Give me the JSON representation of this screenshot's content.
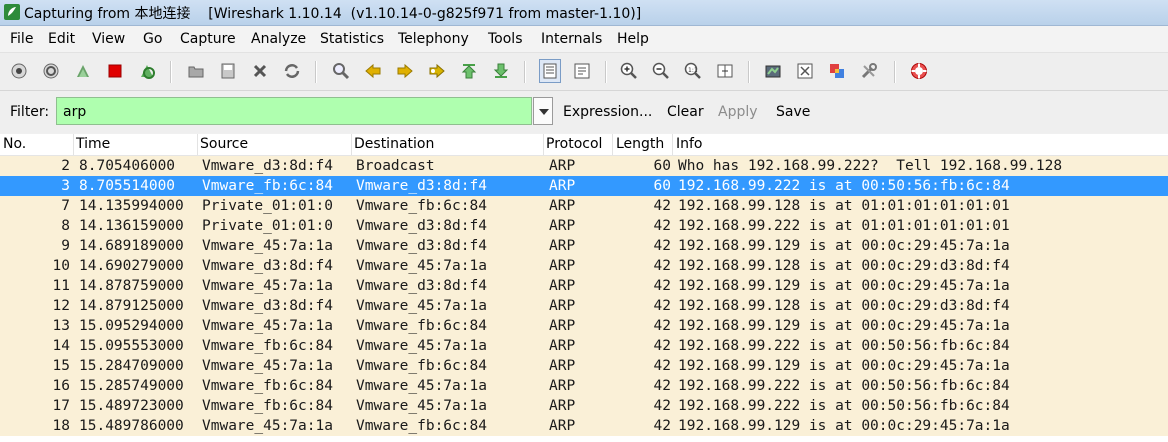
{
  "window": {
    "title": "Capturing from 本地连接    [Wireshark 1.10.14  (v1.10.14-0-g825f971 from master-1.10)]"
  },
  "menu": [
    "File",
    "Edit",
    "View",
    "Go",
    "Capture",
    "Analyze",
    "Statistics",
    "Telephony",
    "Tools",
    "Internals",
    "Help"
  ],
  "toolbar": {
    "icons": [
      "interface-list",
      "capture-options",
      "start-capture",
      "stop-capture",
      "restart-capture",
      "open-file",
      "save-file",
      "close-file",
      "reload-file",
      "find-packet",
      "go-back",
      "go-forward",
      "go-to-packet",
      "go-first",
      "go-last",
      "colorize",
      "auto-scroll",
      "zoom-in",
      "zoom-out",
      "normal-size",
      "resize-columns",
      "capture-filters",
      "display-filters",
      "coloring-rules",
      "preferences",
      "help"
    ]
  },
  "filter": {
    "label": "Filter:",
    "value": "arp",
    "expression_label": "Expression...",
    "clear_label": "Clear",
    "apply_label": "Apply",
    "save_label": "Save"
  },
  "columns": [
    "No.",
    "Time",
    "Source",
    "Destination",
    "Protocol",
    "Length",
    "Info"
  ],
  "packets": [
    {
      "no": "2",
      "time": "8.705406000",
      "source": "Vmware_d3:8d:f4",
      "destination": "Broadcast",
      "protocol": "ARP",
      "length": "60",
      "info": "Who has 192.168.99.222?  Tell 192.168.99.128",
      "selected": false
    },
    {
      "no": "3",
      "time": "8.705514000",
      "source": "Vmware_fb:6c:84",
      "destination": "Vmware_d3:8d:f4",
      "protocol": "ARP",
      "length": "60",
      "info": "192.168.99.222 is at 00:50:56:fb:6c:84",
      "selected": true
    },
    {
      "no": "7",
      "time": "14.135994000",
      "source": "Private_01:01:0",
      "destination": "Vmware_fb:6c:84",
      "protocol": "ARP",
      "length": "42",
      "info": "192.168.99.128 is at 01:01:01:01:01:01",
      "selected": false
    },
    {
      "no": "8",
      "time": "14.136159000",
      "source": "Private_01:01:0",
      "destination": "Vmware_d3:8d:f4",
      "protocol": "ARP",
      "length": "42",
      "info": "192.168.99.222 is at 01:01:01:01:01:01",
      "selected": false
    },
    {
      "no": "9",
      "time": "14.689189000",
      "source": "Vmware_45:7a:1a",
      "destination": "Vmware_d3:8d:f4",
      "protocol": "ARP",
      "length": "42",
      "info": "192.168.99.129 is at 00:0c:29:45:7a:1a",
      "selected": false
    },
    {
      "no": "10",
      "time": "14.690279000",
      "source": "Vmware_d3:8d:f4",
      "destination": "Vmware_45:7a:1a",
      "protocol": "ARP",
      "length": "42",
      "info": "192.168.99.128 is at 00:0c:29:d3:8d:f4",
      "selected": false
    },
    {
      "no": "11",
      "time": "14.878759000",
      "source": "Vmware_45:7a:1a",
      "destination": "Vmware_d3:8d:f4",
      "protocol": "ARP",
      "length": "42",
      "info": "192.168.99.129 is at 00:0c:29:45:7a:1a",
      "selected": false
    },
    {
      "no": "12",
      "time": "14.879125000",
      "source": "Vmware_d3:8d:f4",
      "destination": "Vmware_45:7a:1a",
      "protocol": "ARP",
      "length": "42",
      "info": "192.168.99.128 is at 00:0c:29:d3:8d:f4",
      "selected": false
    },
    {
      "no": "13",
      "time": "15.095294000",
      "source": "Vmware_45:7a:1a",
      "destination": "Vmware_fb:6c:84",
      "protocol": "ARP",
      "length": "42",
      "info": "192.168.99.129 is at 00:0c:29:45:7a:1a",
      "selected": false
    },
    {
      "no": "14",
      "time": "15.095553000",
      "source": "Vmware_fb:6c:84",
      "destination": "Vmware_45:7a:1a",
      "protocol": "ARP",
      "length": "42",
      "info": "192.168.99.222 is at 00:50:56:fb:6c:84",
      "selected": false
    },
    {
      "no": "15",
      "time": "15.284709000",
      "source": "Vmware_45:7a:1a",
      "destination": "Vmware_fb:6c:84",
      "protocol": "ARP",
      "length": "42",
      "info": "192.168.99.129 is at 00:0c:29:45:7a:1a",
      "selected": false
    },
    {
      "no": "16",
      "time": "15.285749000",
      "source": "Vmware_fb:6c:84",
      "destination": "Vmware_45:7a:1a",
      "protocol": "ARP",
      "length": "42",
      "info": "192.168.99.222 is at 00:50:56:fb:6c:84",
      "selected": false
    },
    {
      "no": "17",
      "time": "15.489723000",
      "source": "Vmware_fb:6c:84",
      "destination": "Vmware_45:7a:1a",
      "protocol": "ARP",
      "length": "42",
      "info": "192.168.99.222 is at 00:50:56:fb:6c:84",
      "selected": false
    },
    {
      "no": "18",
      "time": "15.489786000",
      "source": "Vmware_45:7a:1a",
      "destination": "Vmware_fb:6c:84",
      "protocol": "ARP",
      "length": "42",
      "info": "192.168.99.129 is at 00:0c:29:45:7a:1a",
      "selected": false
    }
  ],
  "colors": {
    "row_background": "#faf0d7",
    "selected_row": "#3399ff",
    "filter_valid": "#afffaf"
  }
}
